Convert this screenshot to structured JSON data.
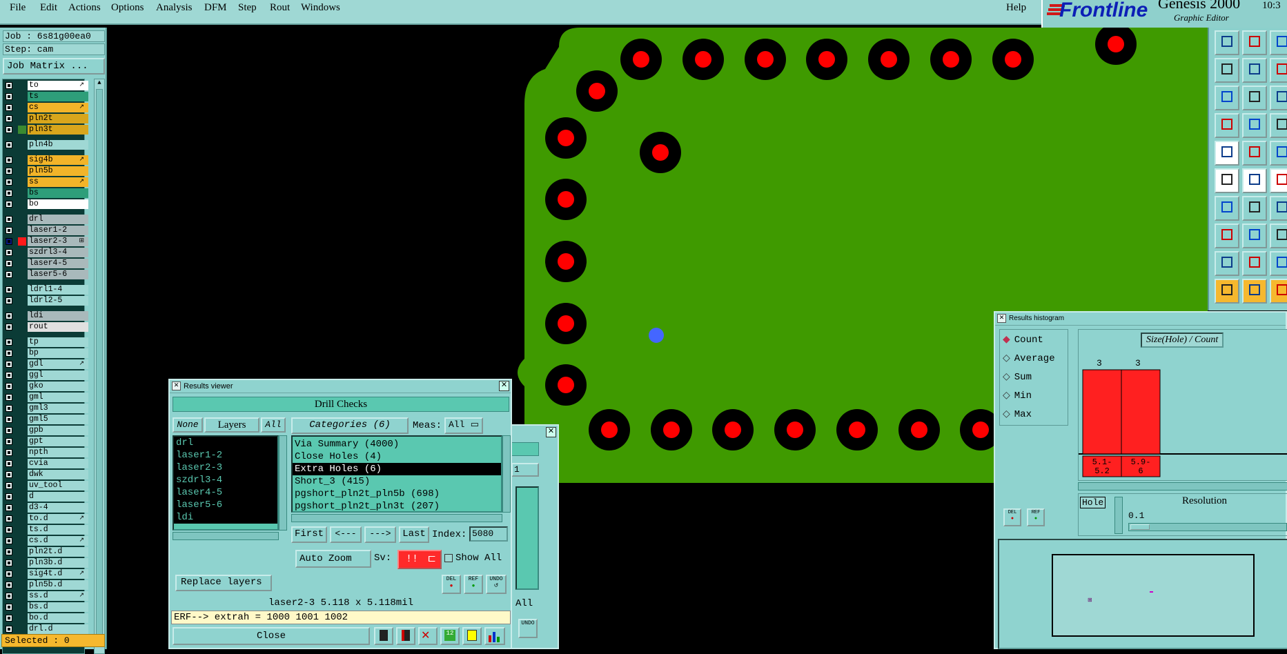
{
  "menu": {
    "items": [
      "File",
      "Edit",
      "Actions",
      "Options",
      "Analysis",
      "DFM",
      "Step",
      "Rout",
      "Windows"
    ],
    "help": "Help"
  },
  "brand": {
    "logo": "Frontline",
    "product": "Genesis 2000",
    "subtitle": "Graphic Editor",
    "clock": "10:3"
  },
  "job": {
    "job_label": "Job : 6s81g00ea0",
    "step_label": "Step: cam",
    "matrix_button": "Job Matrix ...",
    "selected": "Selected : 0"
  },
  "layers": [
    {
      "name": "to",
      "color": "#ffffff",
      "mark": "↗"
    },
    {
      "name": "ts",
      "color": "#2e9e7a",
      "mark": ""
    },
    {
      "name": "cs",
      "color": "#f2b429",
      "mark": "↗"
    },
    {
      "name": "pln2t",
      "color": "#d8a61c",
      "mark": ""
    },
    {
      "name": "pln3t",
      "color": "#d8a61c",
      "mark": ""
    },
    {
      "name": "pln4b",
      "color": "#9fd8d4",
      "mark": ""
    },
    {
      "name": "sig4b",
      "color": "#f2b429",
      "mark": "↗"
    },
    {
      "name": "pln5b",
      "color": "#f2b429",
      "mark": ""
    },
    {
      "name": "ss",
      "color": "#f2b429",
      "mark": "↗"
    },
    {
      "name": "bs",
      "color": "#2e9e7a",
      "mark": ""
    },
    {
      "name": "bo",
      "color": "#ffffff",
      "mark": ""
    },
    {
      "name": "drl",
      "color": "#a9b9bb",
      "mark": ""
    },
    {
      "name": "laser1-2",
      "color": "#a9b9bb",
      "mark": ""
    },
    {
      "name": "laser2-3",
      "color": "#a9b9bb",
      "mark": "⊞"
    },
    {
      "name": "szdrl3-4",
      "color": "#a9b9bb",
      "mark": ""
    },
    {
      "name": "laser4-5",
      "color": "#a9b9bb",
      "mark": ""
    },
    {
      "name": "laser5-6",
      "color": "#a9b9bb",
      "mark": ""
    },
    {
      "name": "ldrl1-4",
      "color": "#9fd8d4",
      "mark": ""
    },
    {
      "name": "ldrl2-5",
      "color": "#9fd8d4",
      "mark": ""
    },
    {
      "name": "ldi",
      "color": "#a9b9bb",
      "mark": ""
    },
    {
      "name": "rout",
      "color": "#e0e0e0",
      "mark": ""
    },
    {
      "name": "tp",
      "color": "#9fd8d4",
      "mark": ""
    },
    {
      "name": "bp",
      "color": "#9fd8d4",
      "mark": ""
    },
    {
      "name": "gdl",
      "color": "#9fd8d4",
      "mark": "↗"
    },
    {
      "name": "ggl",
      "color": "#9fd8d4",
      "mark": ""
    },
    {
      "name": "gko",
      "color": "#9fd8d4",
      "mark": ""
    },
    {
      "name": "gml",
      "color": "#9fd8d4",
      "mark": ""
    },
    {
      "name": "gml3",
      "color": "#9fd8d4",
      "mark": ""
    },
    {
      "name": "gml5",
      "color": "#9fd8d4",
      "mark": ""
    },
    {
      "name": "gpb",
      "color": "#9fd8d4",
      "mark": ""
    },
    {
      "name": "gpt",
      "color": "#9fd8d4",
      "mark": ""
    },
    {
      "name": "npth",
      "color": "#9fd8d4",
      "mark": ""
    },
    {
      "name": "cvia",
      "color": "#9fd8d4",
      "mark": ""
    },
    {
      "name": "dwk",
      "color": "#9fd8d4",
      "mark": ""
    },
    {
      "name": "uv_tool",
      "color": "#9fd8d4",
      "mark": ""
    },
    {
      "name": "d",
      "color": "#9fd8d4",
      "mark": ""
    },
    {
      "name": "d3-4",
      "color": "#9fd8d4",
      "mark": ""
    },
    {
      "name": "to.d",
      "color": "#9fd8d4",
      "mark": "↗"
    },
    {
      "name": "ts.d",
      "color": "#9fd8d4",
      "mark": ""
    },
    {
      "name": "cs.d",
      "color": "#9fd8d4",
      "mark": "↗"
    },
    {
      "name": "pln2t.d",
      "color": "#9fd8d4",
      "mark": ""
    },
    {
      "name": "pln3b.d",
      "color": "#9fd8d4",
      "mark": ""
    },
    {
      "name": "sig4t.d",
      "color": "#9fd8d4",
      "mark": "↗"
    },
    {
      "name": "pln5b.d",
      "color": "#9fd8d4",
      "mark": ""
    },
    {
      "name": "ss.d",
      "color": "#9fd8d4",
      "mark": "↗"
    },
    {
      "name": "bs.d",
      "color": "#9fd8d4",
      "mark": ""
    },
    {
      "name": "bo.d",
      "color": "#9fd8d4",
      "mark": ""
    },
    {
      "name": "drl.d",
      "color": "#9fd8d4",
      "mark": ""
    }
  ],
  "viewer": {
    "title": "Results viewer",
    "section": "Drill Checks",
    "none": "None",
    "layers": "Layers",
    "all": "All",
    "categories": "Categories (6)",
    "meas": "Meas:",
    "meas_value": "All",
    "layer_list": [
      "drl",
      "laser1-2",
      "laser2-3",
      "szdrl3-4",
      "laser4-5",
      "laser5-6",
      "ldi"
    ],
    "category_list": [
      "Via Summary (4000)",
      "Close Holes (4)",
      "Extra Holes (6)",
      "Short_3 (415)",
      "pgshort_pln2t_pln5b (698)",
      "pgshort_pln2t_pln3t (207)"
    ],
    "selected_category": 2,
    "first": "First",
    "prev": "<---",
    "next": "--->",
    "last": "Last",
    "index_label": "Index:",
    "index_value": "5080",
    "auto_zoom": "Auto Zoom",
    "sv": "Sv:",
    "sv_value": "!!",
    "show_all": "Show All",
    "replace": "Replace layers",
    "status": "laser2-3 5.118 x 5.118mil",
    "erf": "ERF--> extrah = 1000 1001 1002",
    "close": "Close",
    "del": "DEL",
    "ref": "REF",
    "undo": "UNDO"
  },
  "back_window": {
    "dropdown": "1",
    "all": "All",
    "undo": "UNDO"
  },
  "histogram": {
    "title": "Results histogram",
    "modes": [
      "Count",
      "Average",
      "Sum",
      "Min",
      "Max"
    ],
    "selected_mode": "Count",
    "chart_title": "Size(Hole) / Count",
    "hole": "Hole",
    "resolution": "Resolution",
    "resolution_value": "0.1",
    "del": "DEL",
    "ref": "REF"
  },
  "chart_data": {
    "type": "bar",
    "title": "Size(Hole) / Count",
    "categories": [
      "5.1-5.2",
      "5.9-6"
    ],
    "values": [
      3,
      3
    ],
    "color": "#ff2020"
  },
  "colors": {
    "board": "#3f9a00",
    "pad": "#000000",
    "hole": "#ff0000",
    "marker": "#4466ff"
  }
}
